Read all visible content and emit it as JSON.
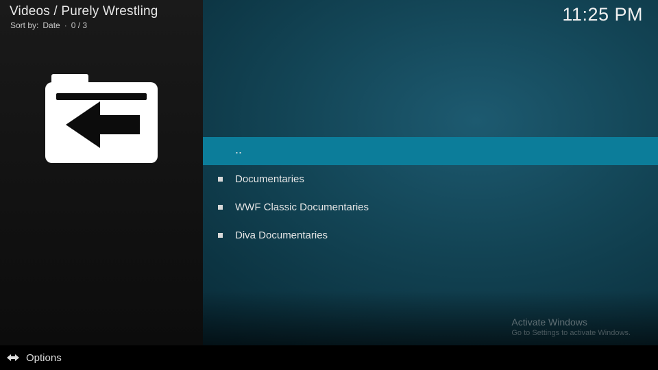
{
  "header": {
    "breadcrumb": "Videos / Purely Wrestling",
    "sort_prefix": "Sort by:",
    "sort_value": "Date",
    "counter": "0 / 3",
    "clock": "11:25 PM"
  },
  "list": {
    "parent_label": "..",
    "items": [
      {
        "label": "Documentaries"
      },
      {
        "label": "WWF Classic Documentaries"
      },
      {
        "label": "Diva Documentaries"
      }
    ],
    "selected_index": -1
  },
  "footer": {
    "options_label": "Options"
  },
  "watermark": {
    "line1": "Activate Windows",
    "line2": "Go to Settings to activate Windows."
  },
  "icons": {
    "back_folder": "back-folder-icon",
    "options_arrows": "options-arrows-icon"
  }
}
